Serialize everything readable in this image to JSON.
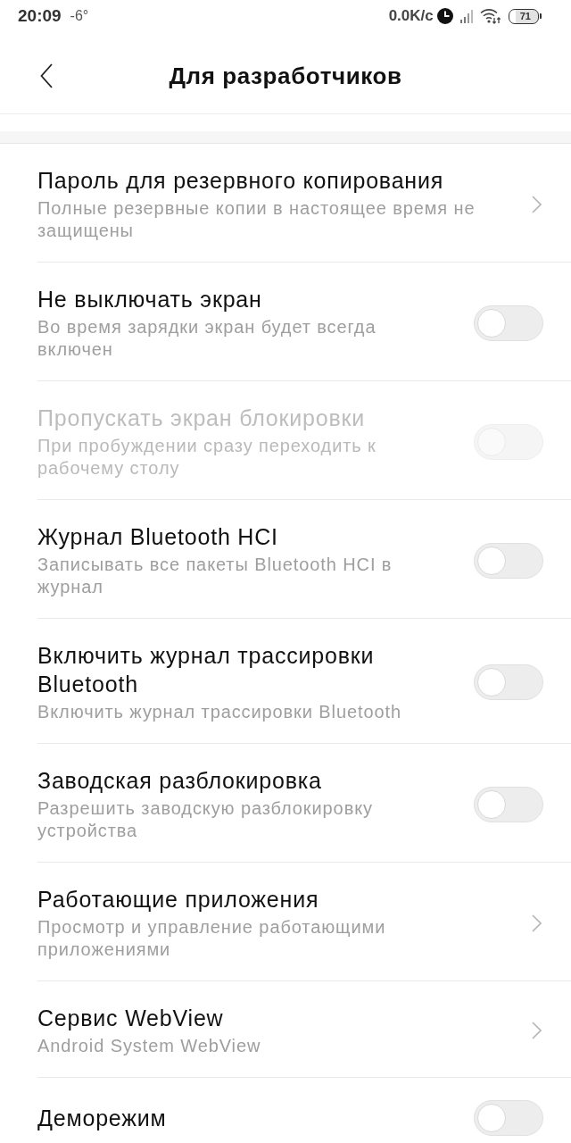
{
  "status_bar": {
    "time": "20:09",
    "temperature": "-6°",
    "network_speed": "0.0K/с",
    "battery": "71"
  },
  "header": {
    "title": "Для разработчиков"
  },
  "items": [
    {
      "kind": "link",
      "title": "Пароль для резервного копирования",
      "subtitle": "Полные резервные копии в настоящее время не защищены",
      "disabled": false
    },
    {
      "kind": "toggle",
      "title": "Не выключать экран",
      "subtitle": "Во время зарядки экран будет всегда включен",
      "on": false,
      "disabled": false
    },
    {
      "kind": "toggle",
      "title": "Пропускать экран блокировки",
      "subtitle": "При пробуждении сразу переходить к рабочему столу",
      "on": false,
      "disabled": true
    },
    {
      "kind": "toggle",
      "title": "Журнал Bluetooth HCI",
      "subtitle": "Записывать все пакеты Bluetooth HCI в журнал",
      "on": false,
      "disabled": false
    },
    {
      "kind": "toggle",
      "title": "Включить журнал трассировки Bluetooth",
      "subtitle": "Включить журнал трассировки Bluetooth",
      "on": false,
      "disabled": false
    },
    {
      "kind": "toggle",
      "title": "Заводская разблокировка",
      "subtitle": "Разрешить заводскую разблокировку устройства",
      "on": false,
      "disabled": false
    },
    {
      "kind": "link",
      "title": "Работающие приложения",
      "subtitle": "Просмотр и управление работающими приложениями",
      "disabled": false
    },
    {
      "kind": "link",
      "title": "Сервис WebView",
      "subtitle": "Android System WebView",
      "disabled": false
    },
    {
      "kind": "toggle",
      "title": "Деморежим",
      "on": false,
      "disabled": false
    }
  ]
}
